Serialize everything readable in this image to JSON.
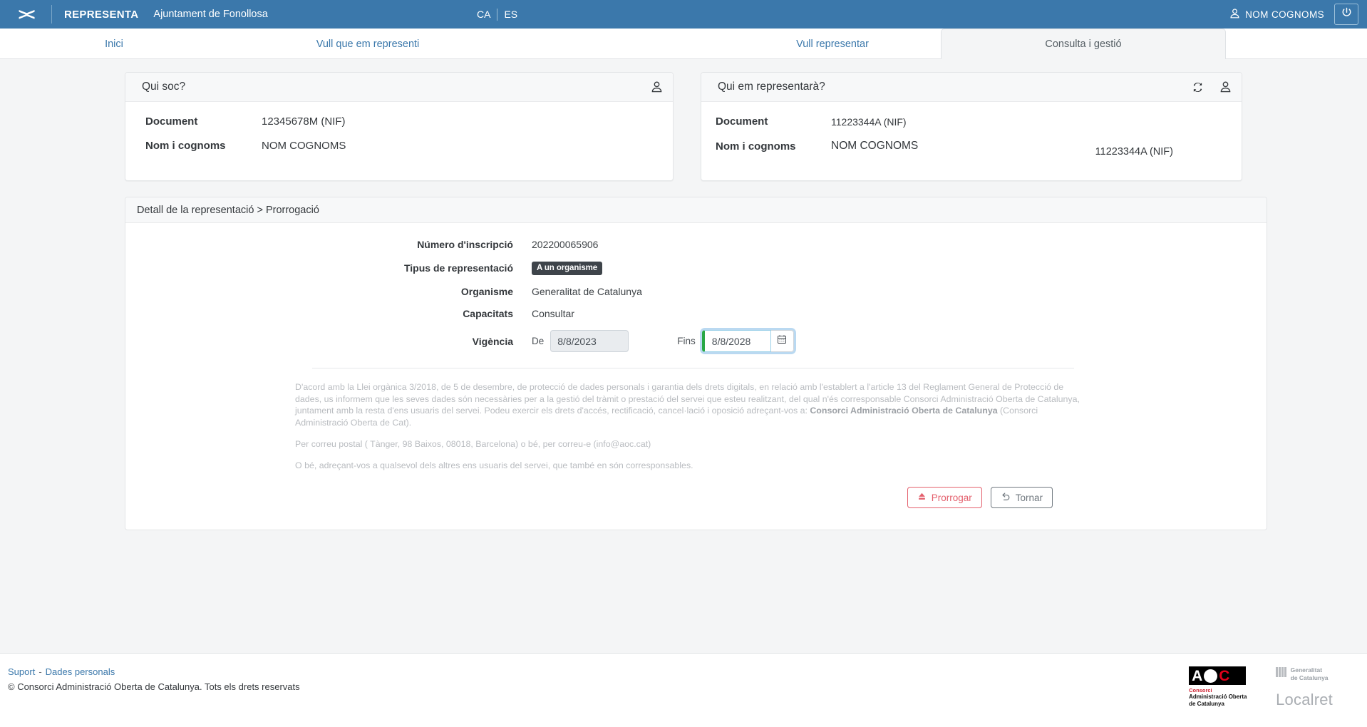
{
  "topbar": {
    "logo_glyph": "><",
    "brand": "REPRESENTA",
    "entity": "Ajuntament de Fonollosa",
    "lang_ca": "CA",
    "lang_es": "ES",
    "user_name": "NOM COGNOMS",
    "user_icon": "person-icon",
    "logout_icon": "power-icon",
    "bg_color": "#3b78ab"
  },
  "tabs": [
    {
      "label": "Inici",
      "active": false
    },
    {
      "label": "Vull que em representi",
      "active": false
    },
    {
      "label": "Vull representar",
      "active": false
    },
    {
      "label": "Consulta i gestió",
      "active": true
    }
  ],
  "card_me": {
    "title": "Qui soc?",
    "icon": "person-icon",
    "rows": [
      {
        "label": "Document",
        "value": "12345678M (NIF)"
      },
      {
        "label": "Nom i cognoms",
        "value": "NOM COGNOMS"
      }
    ]
  },
  "card_rep": {
    "title": "Qui em representarà?",
    "refresh_icon": "refresh-icon",
    "person_icon": "person-icon",
    "rows": [
      {
        "label": "Document",
        "value": "11223344A (NIF)"
      },
      {
        "label": "Nom i cognoms",
        "value": "NOM COGNOMS"
      }
    ],
    "ghost_value": "11223344A (NIF)"
  },
  "detail": {
    "breadcrumb": "Detall de la representació > Prorrogació",
    "fields": [
      {
        "label": "Número d'inscripció",
        "value": "202200065906"
      },
      {
        "label": "Tipus de representació",
        "value": "A un organisme"
      },
      {
        "label": "Organisme",
        "value": "Generalitat de Catalunya"
      },
      {
        "label": "Capacitats",
        "value": "Consultar"
      }
    ],
    "validity": {
      "label": "Vigència",
      "from_label": "De",
      "from_value": "8/8/2023",
      "to_label": "Fins",
      "to_value": "8/8/2028",
      "calendar_icon": "calendar-icon"
    },
    "legal": {
      "p1_a": "D'acord amb la Llei orgànica 3/2018, de 5 de desembre, de protecció de dades personals i garantia dels drets digitals, en relació amb l'establert a l'article 13 del Reglament General de Protecció de dades, us informem que les seves dades són necessàries per a la gestió del tràmit o prestació del servei que esteu realitzant, del qual n'és corresponsable Consorci Administració Oberta de Catalunya, juntament amb la resta d'ens usuaris del servei. Podeu exercir els drets d'accés, rectificació, cancel·lació i oposició adreçant-vos a: ",
      "p1_b": "Consorci Administració Oberta de Catalunya",
      "p1_c": " (Consorci Administració Oberta de Cat).",
      "p2": "Per correu postal ( Tànger, 98 Baixos, 08018, Barcelona) o bé, per correu-e (info@aoc.cat)",
      "p3": "O bé, adreçant-vos a qualsevol dels altres ens usuaris del servei, que també en són corresponsables."
    },
    "buttons": {
      "primary_label": "Prorrogar",
      "primary_icon": "eject-icon",
      "primary_color": "#e4606d",
      "secondary_label": "Tornar",
      "secondary_icon": "undo-icon"
    }
  },
  "footer": {
    "link_support": "Suport",
    "separator": "-",
    "link_privacy": "Dades personals",
    "copyright": "© Consorci Administració Oberta de Catalunya. Tots els drets reservats",
    "logos": {
      "aoc_a": "A",
      "aoc_c": "C",
      "aoc_line1": "Consorci",
      "aoc_line2": "Administració Oberta",
      "aoc_line3": "de Catalunya",
      "gen_line1": "Generalitat",
      "gen_line2": "de Catalunya",
      "localret": "Localret"
    }
  }
}
